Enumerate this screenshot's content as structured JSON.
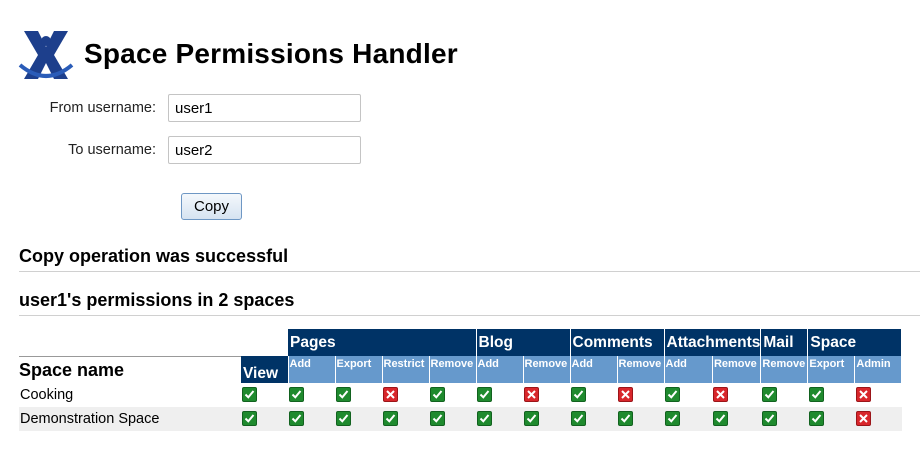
{
  "header": {
    "title": "Space Permissions Handler",
    "logo_icon": "confluence-x-logo-icon"
  },
  "form": {
    "from_label": "From username:",
    "from_value": "user1",
    "to_label": "To username:",
    "to_value": "user2",
    "copy_label": "Copy"
  },
  "messages": {
    "success": "Copy operation was successful",
    "perms_heading": "user1's permissions in 2 spaces"
  },
  "table": {
    "space_name_header": "Space name",
    "view_header": "View",
    "groups": [
      {
        "label": "Pages",
        "span": 4
      },
      {
        "label": "Blog",
        "span": 2
      },
      {
        "label": "Comments",
        "span": 2
      },
      {
        "label": "Attachments",
        "span": 2
      },
      {
        "label": "Mail",
        "span": 1
      },
      {
        "label": "Space",
        "span": 2
      }
    ],
    "subheaders": [
      "Add",
      "Export",
      "Restrict",
      "Remove",
      "Add",
      "Remove",
      "Add",
      "Remove",
      "Add",
      "Remove",
      "Remove",
      "Export",
      "Admin"
    ],
    "rows": [
      {
        "name": "Cooking",
        "perms": [
          true,
          true,
          true,
          false,
          true,
          true,
          false,
          true,
          false,
          true,
          false,
          true,
          true,
          false
        ]
      },
      {
        "name": "Demonstration Space",
        "perms": [
          true,
          true,
          true,
          true,
          true,
          true,
          true,
          true,
          true,
          true,
          true,
          true,
          true,
          false
        ]
      }
    ]
  },
  "colors": {
    "header_dark": "#003366",
    "header_light": "#6699cc",
    "yes": "#1f8a2e",
    "no": "#d8262b"
  }
}
